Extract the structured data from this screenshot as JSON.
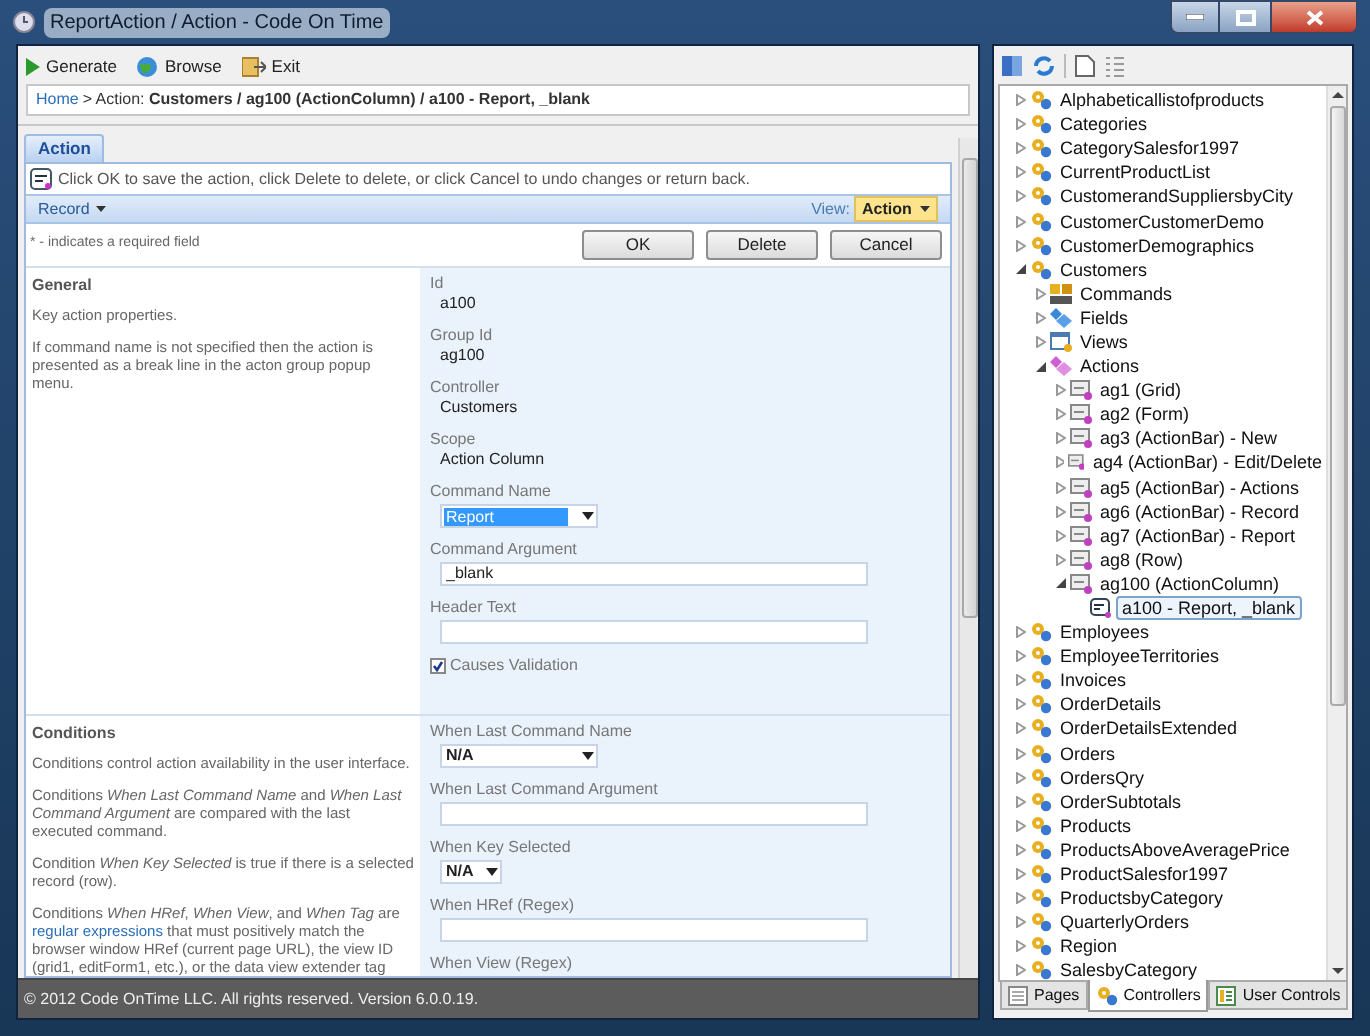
{
  "window": {
    "title": "ReportAction / Action - Code On Time"
  },
  "toolbar": [
    {
      "label": "Generate",
      "kind": "play"
    },
    {
      "label": "Browse",
      "kind": "globe"
    },
    {
      "label": "Exit",
      "kind": "exit"
    }
  ],
  "breadcrumb": {
    "home": "Home",
    "text": "> Action: **Customers / ag100 (ActionColumn) / a100 - Report, _blank**"
  },
  "tabs": [
    {
      "label": "Action",
      "selected": true
    }
  ],
  "description": "Click OK to save the action, click Delete to delete, or click Cancel to undo changes or return back.",
  "action_bar": {
    "menu": "Record",
    "view_label": "View:",
    "view_value": "Action"
  },
  "required_note": "* - indicates a required field",
  "buttons": [
    "OK",
    "Delete",
    "Cancel"
  ],
  "sections": [
    {
      "title": "General",
      "paragraphs": [
        {
          "text": "Key action properties."
        },
        {
          "text": "If command name is not specified then the action is presented as a break line in the acton group popup menu."
        }
      ],
      "fields": [
        {
          "kind": "static",
          "label": "Id",
          "value": "a100"
        },
        {
          "kind": "static",
          "label": "Group Id",
          "value": "ag100"
        },
        {
          "kind": "static",
          "label": "Controller",
          "value": "Customers"
        },
        {
          "kind": "static",
          "label": "Scope",
          "value": "Action Column"
        },
        {
          "kind": "select",
          "label": "Command Name",
          "value": "Report",
          "focused": true,
          "wide": true
        },
        {
          "kind": "text",
          "label": "Command Argument",
          "value": "_blank"
        },
        {
          "kind": "text",
          "label": "Header Text"
        },
        {
          "kind": "checkbox",
          "label": "Causes Validation",
          "checked": true
        }
      ]
    },
    {
      "title": "Conditions",
      "paragraphs": [
        {
          "text": "Conditions control action availability in the user interface."
        },
        {
          "text": "Conditions *When Last Command Name* and *When Last Command Argument* are compared with the last executed command."
        },
        {
          "text": "Condition *When Key Selected* is true if there is a selected record (row)."
        },
        {
          "text": "Conditions *When HRef*, *When View*, and *When Tag* are",
          "link": "regular expressions",
          "after": "that must positively match the browser window HRef (current page URL), the view ID (grid1, editForm1, etc.), or the data view extender tag"
        }
      ],
      "fields": [
        {
          "kind": "select",
          "label": "When Last Command Name",
          "value": "N/A",
          "focused": false,
          "wide": true
        },
        {
          "kind": "text",
          "label": "When Last Command Argument"
        },
        {
          "kind": "select",
          "label": "When Key Selected",
          "value": "N/A",
          "focused": false,
          "wide": false
        },
        {
          "kind": "text",
          "label": "When HRef (Regex)"
        },
        {
          "kind": "label",
          "label": "When View (Regex)"
        }
      ]
    }
  ],
  "status_bar": "© 2012 Code OnTime LLC. All rights reserved. Version 6.0.0.19.",
  "tree": [
    {
      "label": "Alphabeticallistofproducts",
      "kind": "controller",
      "expanded": false,
      "selected": false
    },
    {
      "label": "Categories",
      "kind": "controller",
      "expanded": false,
      "selected": false
    },
    {
      "label": "CategorySalesfor1997",
      "kind": "controller",
      "expanded": false,
      "selected": false
    },
    {
      "label": "CurrentProductList",
      "kind": "controller",
      "expanded": false,
      "selected": false
    },
    {
      "label": "CustomerandSuppliersbyCity",
      "kind": "controller",
      "expanded": false,
      "selected": false
    },
    {
      "label": "CustomerCustomerDemo",
      "kind": "controller",
      "expanded": false,
      "selected": false
    },
    {
      "label": "CustomerDemographics",
      "kind": "controller",
      "expanded": false,
      "selected": false
    },
    {
      "label": "Customers",
      "kind": "controller",
      "expanded": true,
      "selected": false,
      "children": [
        {
          "label": "Commands",
          "kind": "commands",
          "expanded": false,
          "selected": false
        },
        {
          "label": "Fields",
          "kind": "fields",
          "expanded": false,
          "selected": false
        },
        {
          "label": "Views",
          "kind": "views",
          "expanded": false,
          "selected": false
        },
        {
          "label": "Actions",
          "kind": "actions",
          "expanded": true,
          "selected": false,
          "children": [
            {
              "label": "ag1 (Grid)",
              "kind": "group",
              "expanded": false,
              "selected": false
            },
            {
              "label": "ag2 (Form)",
              "kind": "group",
              "expanded": false,
              "selected": false
            },
            {
              "label": "ag3 (ActionBar) - New",
              "kind": "group",
              "expanded": false,
              "selected": false
            },
            {
              "label": "ag4 (ActionBar) - Edit/Delete",
              "kind": "group",
              "expanded": false,
              "selected": false
            },
            {
              "label": "ag5 (ActionBar) - Actions",
              "kind": "group",
              "expanded": false,
              "selected": false
            },
            {
              "label": "ag6 (ActionBar) - Record",
              "kind": "group",
              "expanded": false,
              "selected": false
            },
            {
              "label": "ag7 (ActionBar) - Report",
              "kind": "group",
              "expanded": false,
              "selected": false
            },
            {
              "label": "ag8 (Row)",
              "kind": "group",
              "expanded": false,
              "selected": false
            },
            {
              "label": "ag100 (ActionColumn)",
              "kind": "group",
              "expanded": true,
              "selected": false,
              "children": [
                {
                  "label": "a100 - Report, _blank",
                  "kind": "action",
                  "selected": true
                }
              ]
            }
          ]
        }
      ]
    },
    {
      "label": "Employees",
      "kind": "controller",
      "expanded": false,
      "selected": false
    },
    {
      "label": "EmployeeTerritories",
      "kind": "controller",
      "expanded": false,
      "selected": false
    },
    {
      "label": "Invoices",
      "kind": "controller",
      "expanded": false,
      "selected": false
    },
    {
      "label": "OrderDetails",
      "kind": "controller",
      "expanded": false,
      "selected": false
    },
    {
      "label": "OrderDetailsExtended",
      "kind": "controller",
      "expanded": false,
      "selected": false
    },
    {
      "label": "Orders",
      "kind": "controller",
      "expanded": false,
      "selected": false
    },
    {
      "label": "OrdersQry",
      "kind": "controller",
      "expanded": false,
      "selected": false
    },
    {
      "label": "OrderSubtotals",
      "kind": "controller",
      "expanded": false,
      "selected": false
    },
    {
      "label": "Products",
      "kind": "controller",
      "expanded": false,
      "selected": false
    },
    {
      "label": "ProductsAboveAveragePrice",
      "kind": "controller",
      "expanded": false,
      "selected": false
    },
    {
      "label": "ProductSalesfor1997",
      "kind": "controller",
      "expanded": false,
      "selected": false
    },
    {
      "label": "ProductsbyCategory",
      "kind": "controller",
      "expanded": false,
      "selected": false
    },
    {
      "label": "QuarterlyOrders",
      "kind": "controller",
      "expanded": false,
      "selected": false
    },
    {
      "label": "Region",
      "kind": "controller",
      "expanded": false,
      "selected": false
    },
    {
      "label": "SalesbyCategory",
      "kind": "controller",
      "expanded": false,
      "selected": false
    }
  ],
  "bottom_tabs": [
    {
      "label": "Pages",
      "kind": "pages",
      "selected": false
    },
    {
      "label": "Controllers",
      "kind": "controllers",
      "selected": true
    },
    {
      "label": "User Controls",
      "kind": "controls",
      "selected": false
    }
  ]
}
